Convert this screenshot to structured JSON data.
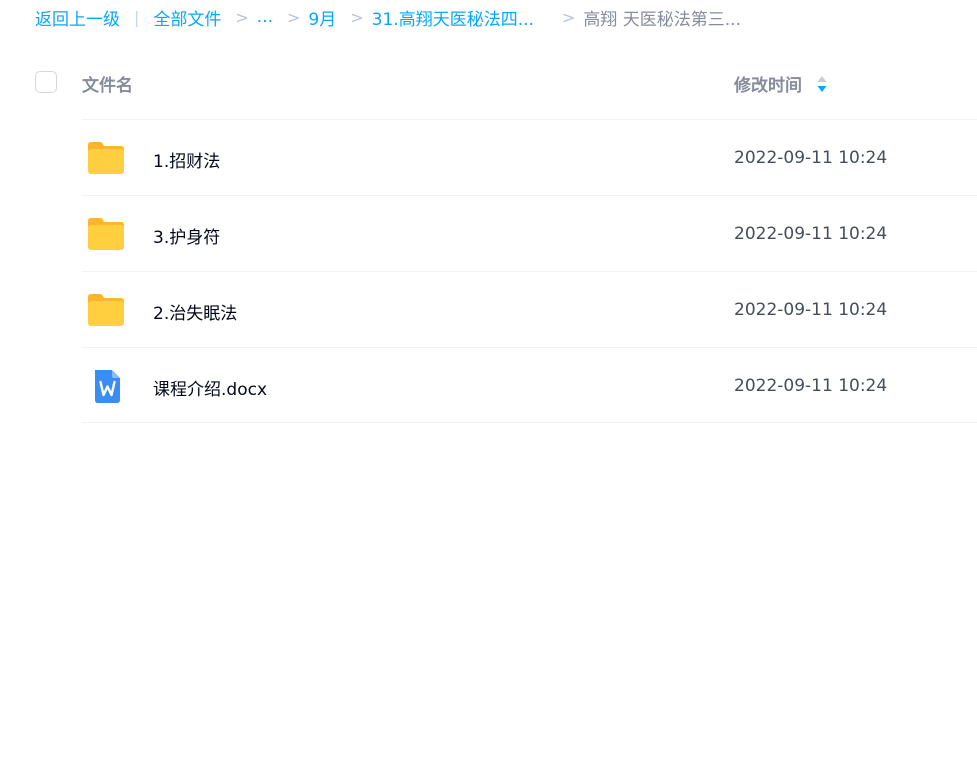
{
  "breadcrumb": {
    "back": "返回上一级",
    "separator_bar": "|",
    "items": [
      "全部文件",
      "...",
      "9月",
      "31.高翔天医秘法四..."
    ],
    "separator": ">",
    "current": "高翔 天医秘法第三..."
  },
  "header": {
    "name_label": "文件名",
    "time_label": "修改时间",
    "sort_icon": "sort-icon"
  },
  "files": [
    {
      "name": "1.招财法",
      "time": "2022-09-11 10:24",
      "icon": "folder-icon"
    },
    {
      "name": "3.护身符",
      "time": "2022-09-11 10:24",
      "icon": "folder-icon"
    },
    {
      "name": "2.治失眠法",
      "time": "2022-09-11 10:24",
      "icon": "folder-icon"
    },
    {
      "name": "课程介绍.docx",
      "time": "2022-09-11 10:24",
      "icon": "word-doc-icon"
    }
  ],
  "colors": {
    "link": "#06a7ff",
    "folder": "#ffc73a",
    "doc": "#3b8cf3"
  }
}
